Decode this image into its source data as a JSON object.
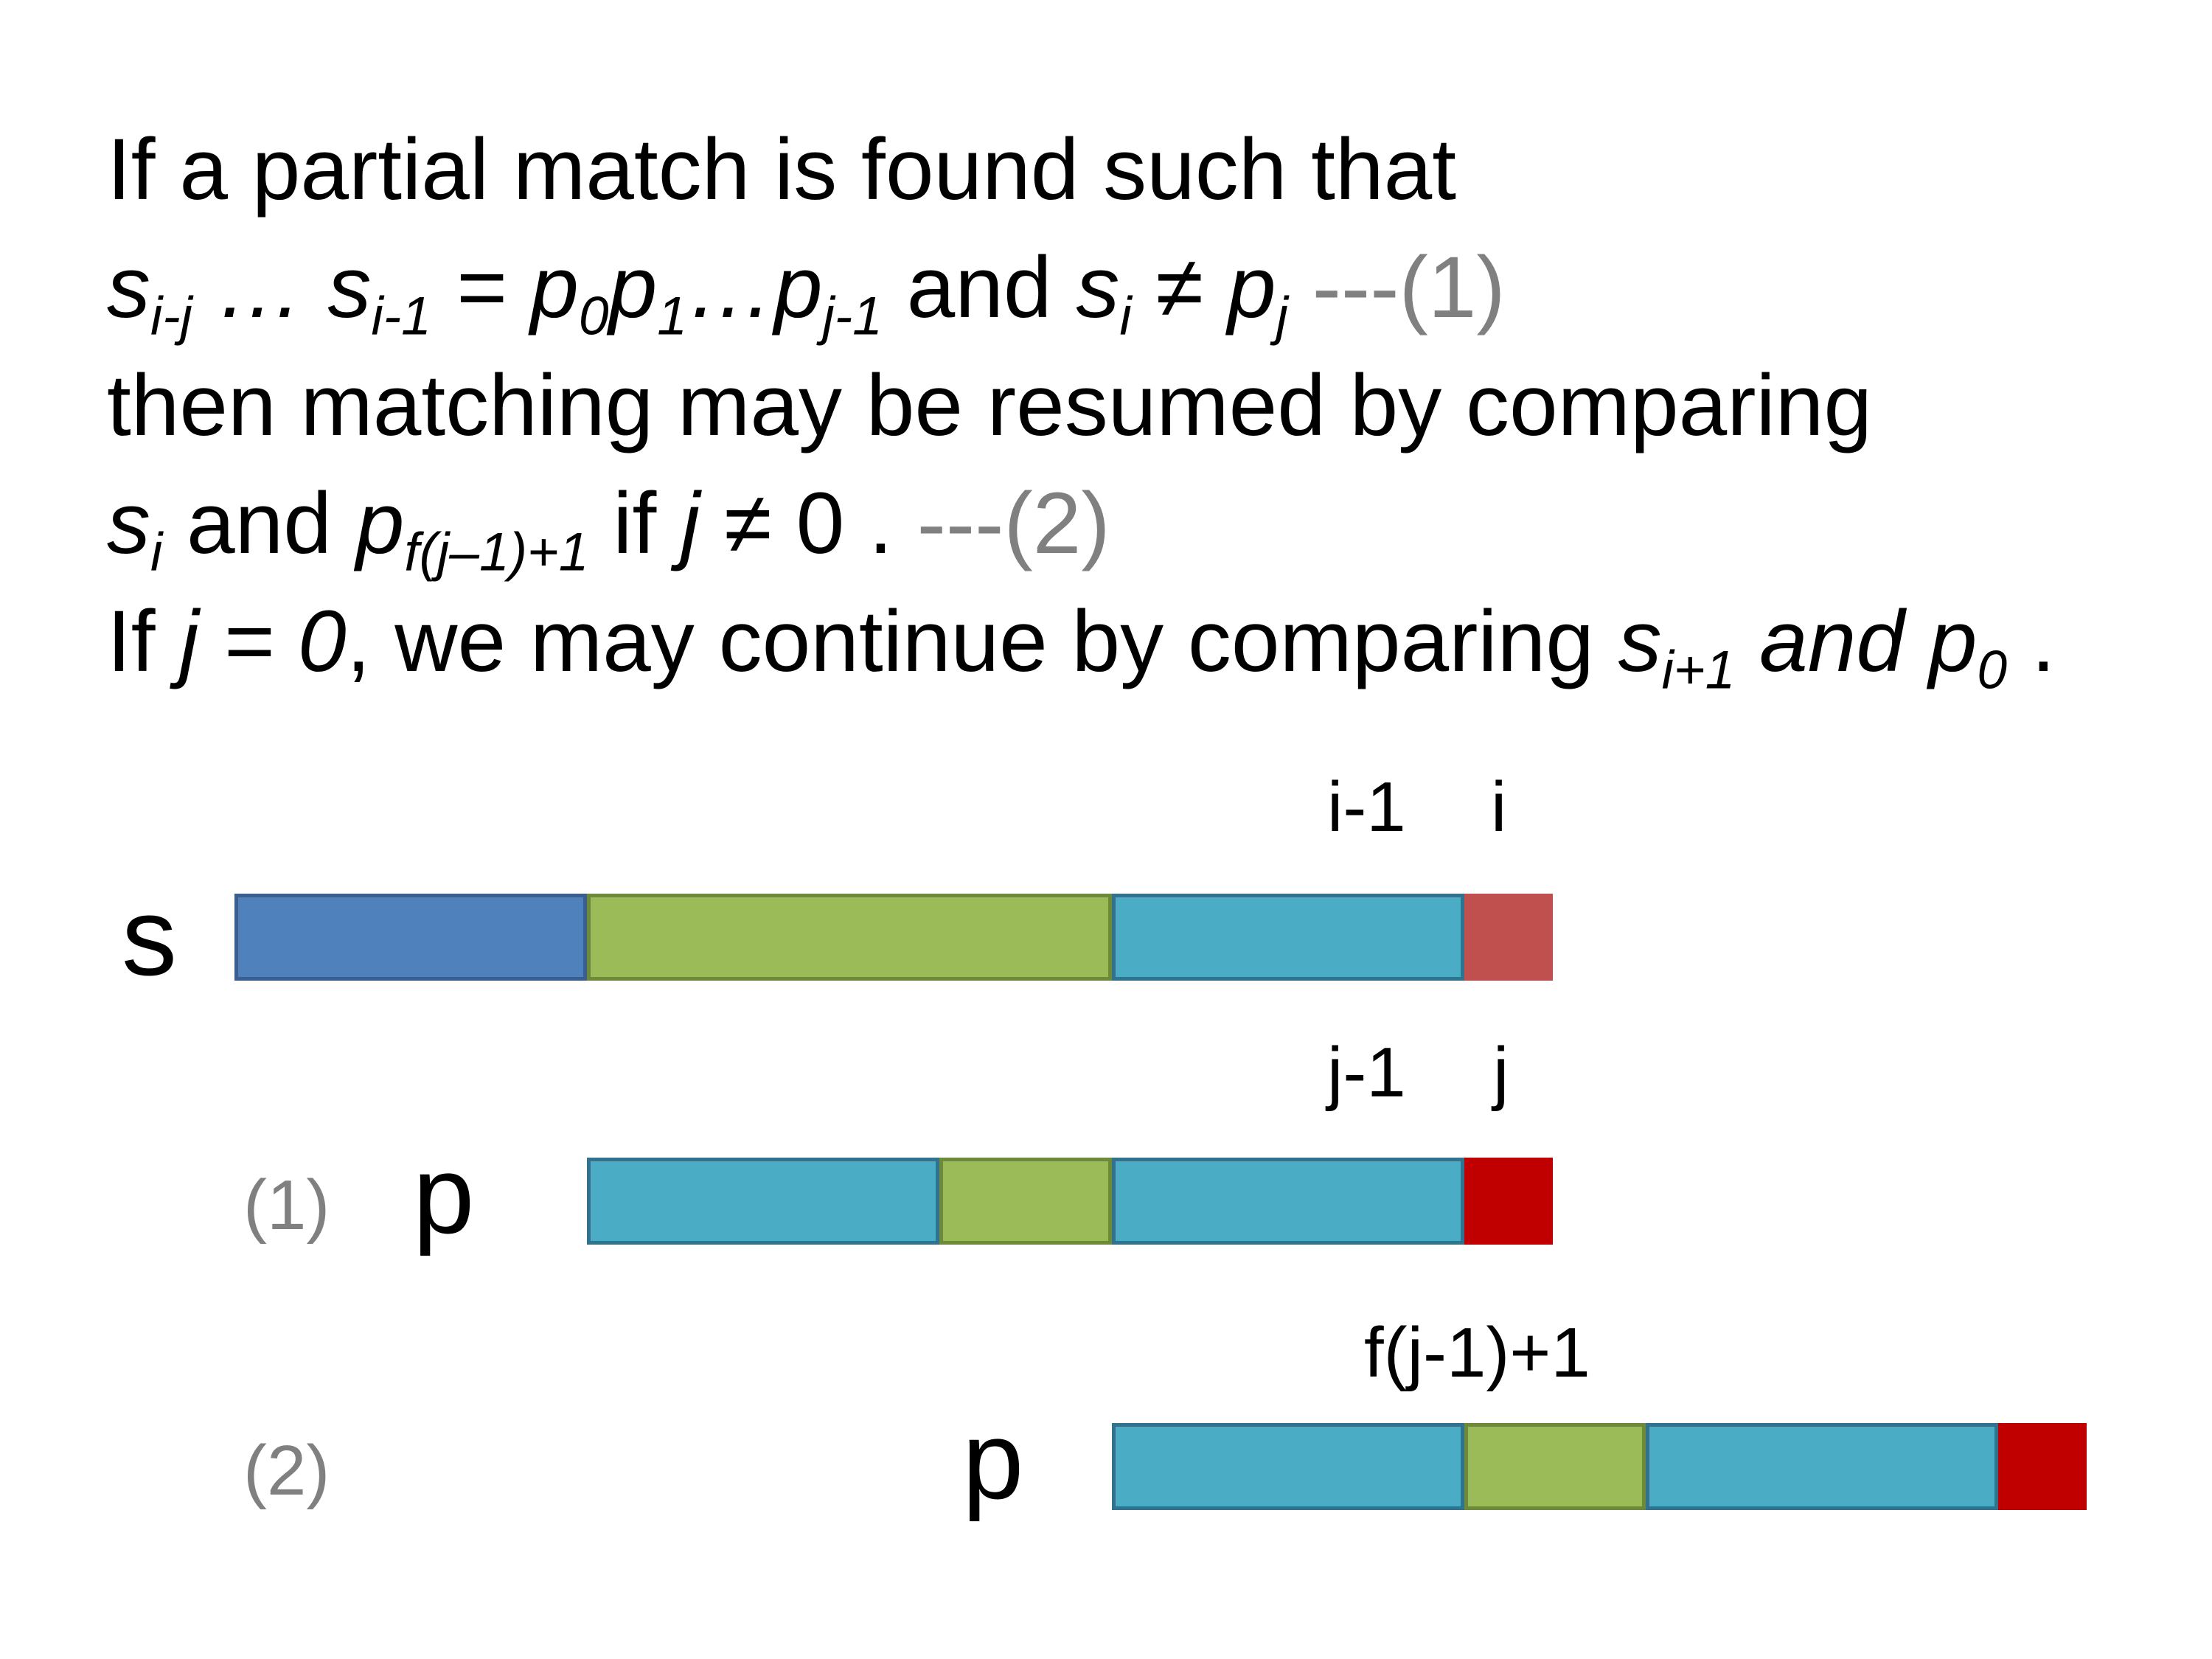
{
  "text": {
    "l1": "If a partial match is found such that",
    "l2": {
      "s1": "s",
      "s1_sub": "i-j",
      "dots1": " … ",
      "s2": "s",
      "s2_sub": "i-1",
      "eq": " = ",
      "p0": "p",
      "p0_sub": "0",
      "p1": "p",
      "p1_sub": "1",
      "dots2": "…",
      "pj1": "p",
      "pj1_sub": "j-1",
      "and": " and ",
      "si": "s",
      "si_sub": "i",
      "neq": " ≠ ",
      "pj": "p",
      "pj_sub": "j",
      "ref": " ---(1)"
    },
    "l3": "then matching may be resumed by comparing",
    "l4": {
      "si": "s",
      "si_sub": "i",
      "and": " and ",
      "p": "p",
      "p_sub": "f(j–1)+1",
      "if": "  if ",
      "j": "j",
      "rest": " ≠ 0 . ",
      "ref": "---(2)"
    },
    "l5": {
      "if": "If ",
      "cond": "j = 0",
      "mid": ", we may continue by comparing ",
      "s": "s",
      "s_sub": "i+1",
      "and": " and ",
      "p": "p",
      "p_sub": "0",
      "end": " ."
    }
  },
  "diagram": {
    "s_label": "s",
    "s_idx_left": "i-1",
    "s_idx_right": "i",
    "p1_tag": "(1)",
    "p1_label": "p",
    "p1_idx_left": "j-1",
    "p1_idx_right": "j",
    "p2_tag": "(2)",
    "p2_label": "p",
    "p2_idx": "f(j-1)+1"
  },
  "colors": {
    "blue": "#4f81bd",
    "green": "#9bbb59",
    "teal": "#4bacc6",
    "rose": "#c0504d",
    "red": "#c00000",
    "gray_text": "#808080"
  }
}
